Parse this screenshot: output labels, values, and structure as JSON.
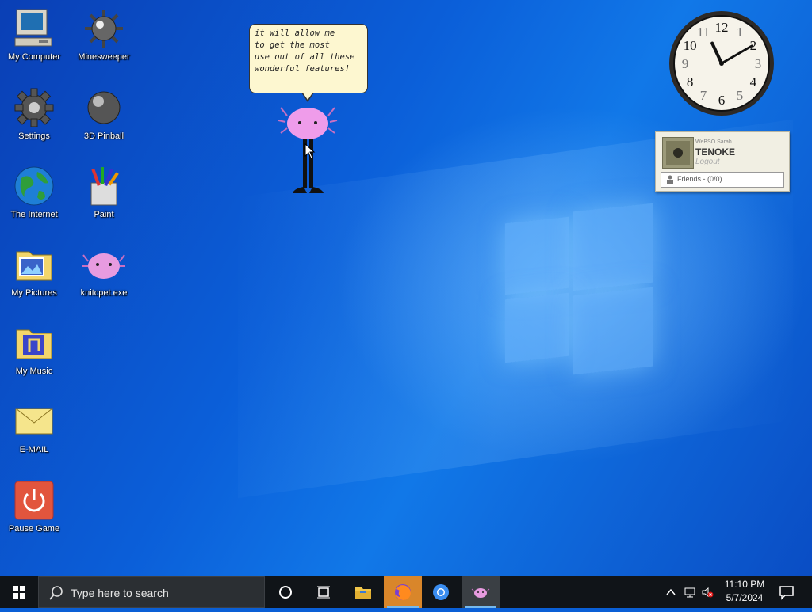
{
  "desktop": {
    "icons": [
      {
        "label": "My Computer",
        "icon": "computer-icon"
      },
      {
        "label": "Minesweeper",
        "icon": "mine-icon"
      },
      {
        "label": "Settings",
        "icon": "gear-icon"
      },
      {
        "label": "3D Pinball",
        "icon": "pinball-icon"
      },
      {
        "label": "The Internet",
        "icon": "globe-icon"
      },
      {
        "label": "Paint",
        "icon": "paint-icon"
      },
      {
        "label": "My Pictures",
        "icon": "pictures-folder-icon"
      },
      {
        "label": "knitcpet.exe",
        "icon": "axolotl-icon"
      },
      {
        "label": "My Music",
        "icon": "music-folder-icon"
      },
      {
        "label": "E-MAIL",
        "icon": "envelope-icon"
      },
      {
        "label": "Pause Game",
        "icon": "power-icon"
      }
    ]
  },
  "pet": {
    "speech_lines": [
      "it will allow me",
      "to get the most",
      "use out of all these",
      "wonderful features!"
    ]
  },
  "messenger_widget": {
    "small_text": "WeBSO Sarah",
    "username": "TENOKE",
    "logout_label": "Logout",
    "friends_label": "Friends - (0/0)"
  },
  "analog_clock": {
    "numerals": [
      "12",
      "1",
      "2",
      "3",
      "4",
      "5",
      "6",
      "7",
      "8",
      "9",
      "10",
      "11"
    ],
    "time": "11:10"
  },
  "taskbar": {
    "search_placeholder": "Type here to search",
    "time": "11:10 PM",
    "date": "5/7/2024",
    "colors": {
      "accent": "#76b9ed",
      "bar": "#101418"
    }
  }
}
